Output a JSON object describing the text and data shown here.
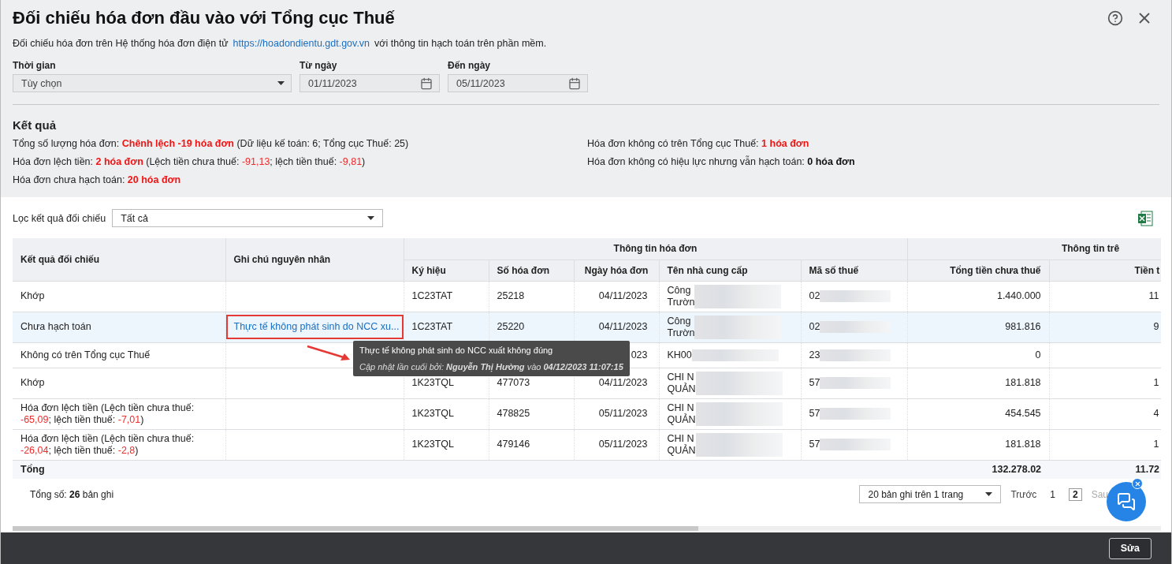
{
  "dialog": {
    "title": "Đối chiếu hóa đơn đầu vào với Tổng cục Thuế",
    "subtitle": "Đối chiếu hóa đơn trên Hệ thống hóa đơn điện tử",
    "subtitle_link": "https://hoadondientu.gdt.gov.vn",
    "subtitle_suffix": "với thông tin hạch toán trên phần mềm."
  },
  "filters": [
    {
      "kind": "select",
      "label": "Thời gian",
      "value": "Tùy chọn"
    },
    {
      "kind": "date",
      "label": "Từ ngày",
      "value": "01/11/2023"
    },
    {
      "kind": "date",
      "label": "Đến ngày",
      "value": "05/11/2023"
    }
  ],
  "results": {
    "title": "Kết quả",
    "left": [
      [
        {
          "text": "Tổng số lượng hóa đơn:  ",
          "kind": "plain"
        },
        {
          "text": "Chênh lệch -19 hóa đơn",
          "kind": "alert-count"
        },
        {
          "text": " (Dữ liệu kế toán: 6; Tổng cục Thuế: 25)",
          "kind": "plain"
        }
      ],
      [
        {
          "text": "Hóa đơn lệch tiền: ",
          "kind": "plain"
        },
        {
          "text": "2 hóa đơn",
          "kind": "alert-count"
        },
        {
          "text": " (Lệch tiền chưa thuế: ",
          "kind": "plain"
        },
        {
          "text": "-91,13",
          "kind": "negative"
        },
        {
          "text": "; lệch tiền thuế: ",
          "kind": "plain"
        },
        {
          "text": "-9,81",
          "kind": "negative"
        },
        {
          "text": ")",
          "kind": "plain"
        }
      ],
      [
        {
          "text": "Hóa đơn chưa hạch toán: ",
          "kind": "plain"
        },
        {
          "text": "20 hóa đơn",
          "kind": "alert-count"
        }
      ]
    ],
    "right": [
      [
        {
          "text": "Hóa đơn không có trên Tổng cục Thuế: ",
          "kind": "plain"
        },
        {
          "text": "1 hóa đơn",
          "kind": "alert-count"
        }
      ],
      [
        {
          "text": "Hóa đơn không có hiệu lực nhưng vẫn hạch toán: ",
          "kind": "plain"
        },
        {
          "text": "0 hóa đơn",
          "kind": "count"
        }
      ]
    ]
  },
  "table_filter": {
    "label": "Lọc kết quả đối chiếu",
    "value": "Tất cả"
  },
  "table": {
    "columns": [
      {
        "label": "Kết quả đối chiếu"
      },
      {
        "label": "Ghi chú nguyên nhân"
      }
    ],
    "groups": [
      {
        "label": "Thông tin hóa đơn",
        "columns": [
          "Ký hiệu",
          "Số hóa đơn",
          "Ngày hóa đơn",
          "Tên nhà cung cấp",
          "Mã số thuế"
        ]
      },
      {
        "label": "Thông tin trê",
        "columns": [
          "Tổng tiền chưa thuế",
          "Tiền t"
        ]
      }
    ],
    "rows": [
      {
        "selected": false,
        "result": [
          {
            "text": "Khớp",
            "kind": "plain"
          }
        ],
        "symbol": "1C23TAT",
        "number": "25218",
        "date": "04/11/2023",
        "supplier": [
          "Công",
          "Trườn"
        ],
        "tax_code": "02",
        "amount": "1.440.000",
        "tax": "11"
      },
      {
        "selected": true,
        "result": [
          {
            "text": "Chưa hạch toán",
            "kind": "plain"
          }
        ],
        "note": "Thực tế không phát sinh do NCC xu...",
        "symbol": "1C23TAT",
        "number": "25220",
        "date": "04/11/2023",
        "supplier": [
          "Công",
          "Trườn"
        ],
        "tax_code": "02",
        "amount": "981.816",
        "tax": "9"
      },
      {
        "selected": false,
        "result": [
          {
            "text": "Không có trên Tổng cục Thuế",
            "kind": "plain"
          }
        ],
        "date": "023",
        "supplier": [
          "KH00"
        ],
        "tax_code": "23",
        "amount": "0"
      },
      {
        "selected": false,
        "result": [
          {
            "text": "Khớp",
            "kind": "plain"
          }
        ],
        "symbol": "1K23TQL",
        "number": "477073",
        "date": "04/11/2023",
        "supplier": [
          "CHI N",
          "QUẢN"
        ],
        "tax_code": "57",
        "amount": "181.818",
        "tax": "1"
      },
      {
        "selected": false,
        "result": [
          {
            "text": "Hóa đơn lệch tiền (Lệch tiền chưa thuế: ",
            "kind": "plain"
          },
          {
            "text": "-65,09",
            "kind": "negative"
          },
          {
            "text": "; lệch tiền thuế: ",
            "kind": "plain"
          },
          {
            "text": "-7,01",
            "kind": "negative"
          },
          {
            "text": ")",
            "kind": "plain"
          }
        ],
        "symbol": "1K23TQL",
        "number": "478825",
        "date": "05/11/2023",
        "supplier": [
          "CHI N",
          "QUẢN"
        ],
        "tax_code": "57",
        "amount": "454.545",
        "tax": "4"
      },
      {
        "selected": false,
        "result": [
          {
            "text": "Hóa đơn lệch tiền (Lệch tiền chưa thuế: ",
            "kind": "plain"
          },
          {
            "text": "-26,04",
            "kind": "negative"
          },
          {
            "text": "; lệch tiền thuế: ",
            "kind": "plain"
          },
          {
            "text": "-2,8",
            "kind": "negative"
          },
          {
            "text": ")",
            "kind": "plain"
          }
        ],
        "symbol": "1K23TQL",
        "number": "479146",
        "date": "05/11/2023",
        "supplier": [
          "CHI N",
          "QUẢN"
        ],
        "tax_code": "57",
        "amount": "181.818",
        "tax": "1"
      }
    ],
    "total": {
      "label": "Tổng",
      "amount": "132.278.02",
      "tax": "11.72"
    }
  },
  "tooltip": {
    "title": "Thực tế không phát sinh do NCC xuất không đúng",
    "meta": "Cập nhật lần cuối bởi: **Nguyễn Thị Hường** vào **04/12/2023 11:07:15**"
  },
  "pagination": {
    "summary": [
      {
        "text": "Tổng số: ",
        "kind": "plain"
      },
      {
        "text": "26",
        "kind": "count"
      },
      {
        "text": " bản ghi",
        "kind": "plain"
      }
    ],
    "page_size": "20 bản ghi trên 1 trang",
    "prev": "Trước",
    "pages": [
      {
        "label": "1",
        "selected": false
      },
      {
        "label": "2",
        "selected": true
      }
    ],
    "next": "Sau",
    "next_disabled": true
  },
  "footer": {
    "button": "Sửa"
  }
}
